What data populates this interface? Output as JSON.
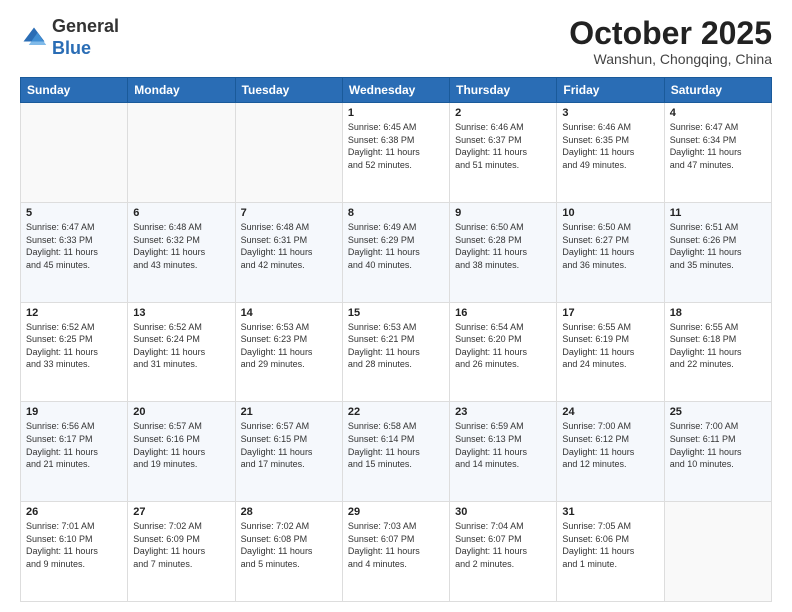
{
  "header": {
    "logo_line1": "General",
    "logo_line2": "Blue",
    "month_title": "October 2025",
    "location": "Wanshun, Chongqing, China"
  },
  "days_of_week": [
    "Sunday",
    "Monday",
    "Tuesday",
    "Wednesday",
    "Thursday",
    "Friday",
    "Saturday"
  ],
  "weeks": [
    [
      {
        "num": "",
        "info": ""
      },
      {
        "num": "",
        "info": ""
      },
      {
        "num": "",
        "info": ""
      },
      {
        "num": "1",
        "info": "Sunrise: 6:45 AM\nSunset: 6:38 PM\nDaylight: 11 hours\nand 52 minutes."
      },
      {
        "num": "2",
        "info": "Sunrise: 6:46 AM\nSunset: 6:37 PM\nDaylight: 11 hours\nand 51 minutes."
      },
      {
        "num": "3",
        "info": "Sunrise: 6:46 AM\nSunset: 6:35 PM\nDaylight: 11 hours\nand 49 minutes."
      },
      {
        "num": "4",
        "info": "Sunrise: 6:47 AM\nSunset: 6:34 PM\nDaylight: 11 hours\nand 47 minutes."
      }
    ],
    [
      {
        "num": "5",
        "info": "Sunrise: 6:47 AM\nSunset: 6:33 PM\nDaylight: 11 hours\nand 45 minutes."
      },
      {
        "num": "6",
        "info": "Sunrise: 6:48 AM\nSunset: 6:32 PM\nDaylight: 11 hours\nand 43 minutes."
      },
      {
        "num": "7",
        "info": "Sunrise: 6:48 AM\nSunset: 6:31 PM\nDaylight: 11 hours\nand 42 minutes."
      },
      {
        "num": "8",
        "info": "Sunrise: 6:49 AM\nSunset: 6:29 PM\nDaylight: 11 hours\nand 40 minutes."
      },
      {
        "num": "9",
        "info": "Sunrise: 6:50 AM\nSunset: 6:28 PM\nDaylight: 11 hours\nand 38 minutes."
      },
      {
        "num": "10",
        "info": "Sunrise: 6:50 AM\nSunset: 6:27 PM\nDaylight: 11 hours\nand 36 minutes."
      },
      {
        "num": "11",
        "info": "Sunrise: 6:51 AM\nSunset: 6:26 PM\nDaylight: 11 hours\nand 35 minutes."
      }
    ],
    [
      {
        "num": "12",
        "info": "Sunrise: 6:52 AM\nSunset: 6:25 PM\nDaylight: 11 hours\nand 33 minutes."
      },
      {
        "num": "13",
        "info": "Sunrise: 6:52 AM\nSunset: 6:24 PM\nDaylight: 11 hours\nand 31 minutes."
      },
      {
        "num": "14",
        "info": "Sunrise: 6:53 AM\nSunset: 6:23 PM\nDaylight: 11 hours\nand 29 minutes."
      },
      {
        "num": "15",
        "info": "Sunrise: 6:53 AM\nSunset: 6:21 PM\nDaylight: 11 hours\nand 28 minutes."
      },
      {
        "num": "16",
        "info": "Sunrise: 6:54 AM\nSunset: 6:20 PM\nDaylight: 11 hours\nand 26 minutes."
      },
      {
        "num": "17",
        "info": "Sunrise: 6:55 AM\nSunset: 6:19 PM\nDaylight: 11 hours\nand 24 minutes."
      },
      {
        "num": "18",
        "info": "Sunrise: 6:55 AM\nSunset: 6:18 PM\nDaylight: 11 hours\nand 22 minutes."
      }
    ],
    [
      {
        "num": "19",
        "info": "Sunrise: 6:56 AM\nSunset: 6:17 PM\nDaylight: 11 hours\nand 21 minutes."
      },
      {
        "num": "20",
        "info": "Sunrise: 6:57 AM\nSunset: 6:16 PM\nDaylight: 11 hours\nand 19 minutes."
      },
      {
        "num": "21",
        "info": "Sunrise: 6:57 AM\nSunset: 6:15 PM\nDaylight: 11 hours\nand 17 minutes."
      },
      {
        "num": "22",
        "info": "Sunrise: 6:58 AM\nSunset: 6:14 PM\nDaylight: 11 hours\nand 15 minutes."
      },
      {
        "num": "23",
        "info": "Sunrise: 6:59 AM\nSunset: 6:13 PM\nDaylight: 11 hours\nand 14 minutes."
      },
      {
        "num": "24",
        "info": "Sunrise: 7:00 AM\nSunset: 6:12 PM\nDaylight: 11 hours\nand 12 minutes."
      },
      {
        "num": "25",
        "info": "Sunrise: 7:00 AM\nSunset: 6:11 PM\nDaylight: 11 hours\nand 10 minutes."
      }
    ],
    [
      {
        "num": "26",
        "info": "Sunrise: 7:01 AM\nSunset: 6:10 PM\nDaylight: 11 hours\nand 9 minutes."
      },
      {
        "num": "27",
        "info": "Sunrise: 7:02 AM\nSunset: 6:09 PM\nDaylight: 11 hours\nand 7 minutes."
      },
      {
        "num": "28",
        "info": "Sunrise: 7:02 AM\nSunset: 6:08 PM\nDaylight: 11 hours\nand 5 minutes."
      },
      {
        "num": "29",
        "info": "Sunrise: 7:03 AM\nSunset: 6:07 PM\nDaylight: 11 hours\nand 4 minutes."
      },
      {
        "num": "30",
        "info": "Sunrise: 7:04 AM\nSunset: 6:07 PM\nDaylight: 11 hours\nand 2 minutes."
      },
      {
        "num": "31",
        "info": "Sunrise: 7:05 AM\nSunset: 6:06 PM\nDaylight: 11 hours\nand 1 minute."
      },
      {
        "num": "",
        "info": ""
      }
    ]
  ]
}
